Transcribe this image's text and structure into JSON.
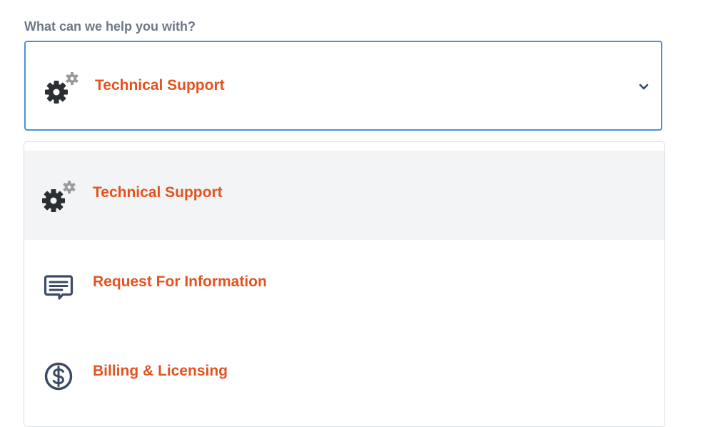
{
  "form": {
    "label": "What can we help you with?"
  },
  "select": {
    "selected_label": "Technical Support",
    "selected_icon": "gears-icon"
  },
  "options": [
    {
      "label": "Technical Support",
      "icon": "gears-icon",
      "highlighted": true
    },
    {
      "label": "Request For Information",
      "icon": "message-icon",
      "highlighted": false
    },
    {
      "label": "Billing & Licensing",
      "icon": "dollar-circle-icon",
      "highlighted": false
    }
  ],
  "colors": {
    "accent_orange": "#e35320",
    "focus_blue": "#4a90e2",
    "icon_dark": "#2b2f33",
    "icon_gray": "#9a9a9a",
    "icon_navy": "#3c4a64",
    "label_gray": "#6b7785",
    "highlight_bg": "#f3f4f6"
  }
}
